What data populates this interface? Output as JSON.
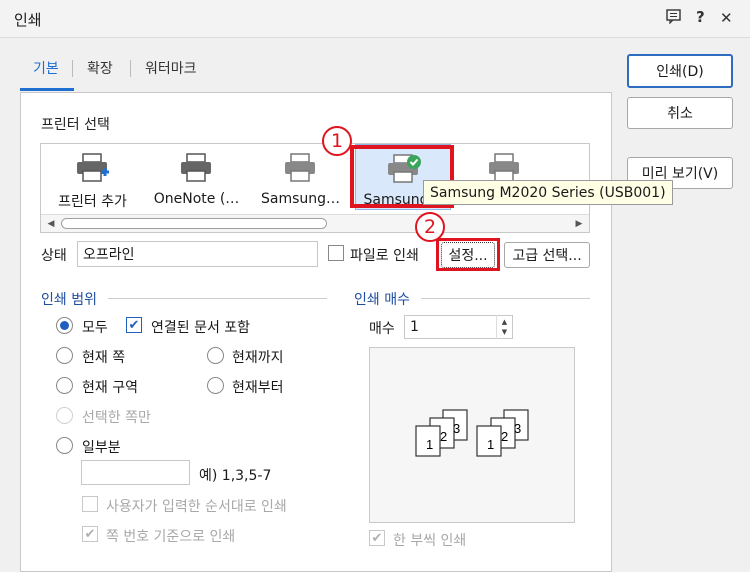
{
  "window": {
    "title": "인쇄",
    "icons": [
      "feedback-icon",
      "help-icon",
      "close-icon"
    ],
    "help_glyph": "?",
    "close_glyph": "✕"
  },
  "tabs": [
    {
      "label": "기본",
      "active": true
    },
    {
      "label": "확장"
    },
    {
      "label": "워터마크"
    }
  ],
  "buttons": {
    "print": "인쇄(D)",
    "cancel": "취소",
    "preview": "미리 보기(V)",
    "setup": "설정...",
    "advanced": "고급 선택..."
  },
  "printer_section": {
    "label": "프린터 선택",
    "printers": [
      {
        "label": "프린터 추가",
        "icon": "add-printer-icon"
      },
      {
        "label": "OneNote (…",
        "icon": "printer-icon"
      },
      {
        "label": "Samsung…",
        "icon": "printer-icon"
      },
      {
        "label": "Samsung…",
        "icon": "printer-default-icon",
        "selected": true
      },
      {
        "label": "",
        "icon": "printer-icon"
      }
    ]
  },
  "tooltip": "Samsung M2020 Series (USB001)",
  "callouts": [
    "1",
    "2"
  ],
  "status": {
    "label": "상태",
    "value": "오프라인"
  },
  "print_to_file": {
    "label": "파일로 인쇄",
    "checked": false
  },
  "print_range": {
    "label": "인쇄 범위",
    "all": "모두",
    "linked_docs": "연결된 문서 포함",
    "current_page": "현재 쪽",
    "until_current": "현재까지",
    "current_section": "현재 구역",
    "from_current": "현재부터",
    "selection_only": "선택한 쪽만",
    "partial": "일부분",
    "example": "예) 1,3,5-7",
    "user_order": "사용자가 입력한 순서대로 인쇄",
    "page_number_basis": "쪽 번호 기준으로 인쇄",
    "selected": "all"
  },
  "copies": {
    "label": "인쇄 매수",
    "count_label": "매수",
    "count": "1",
    "collate": "한 부씩 인쇄",
    "preview_pages": [
      "1",
      "2",
      "3"
    ]
  },
  "colors": {
    "accent": "#1f5fbf",
    "callout": "#e0141e",
    "tooltip_bg": "#ffffe6"
  }
}
